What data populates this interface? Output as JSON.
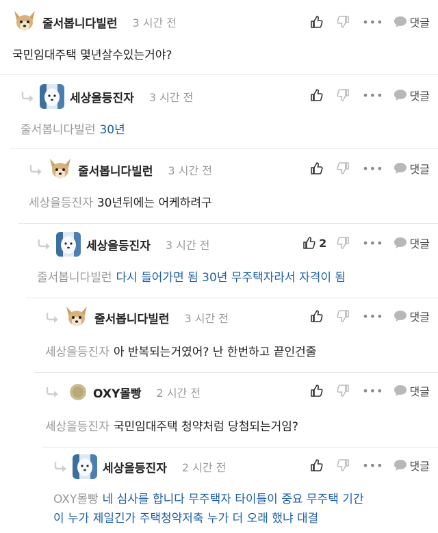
{
  "comments": [
    {
      "nick": "줄서봅니다빌런",
      "time": "3 시간 전",
      "likes": "",
      "mention": "",
      "text": "국민임대주택 몇년살수있는거야?",
      "reply_label": "댓글"
    },
    {
      "nick": "세상을등진자",
      "time": "3 시간 전",
      "likes": "",
      "mention": "줄서봅니다빌런",
      "text": "30년",
      "reply_label": "댓글"
    },
    {
      "nick": "줄서봅니다빌런",
      "time": "3 시간 전",
      "likes": "",
      "mention": "세상을등진자",
      "text": "30년뒤에는 어케하려구",
      "reply_label": "댓글"
    },
    {
      "nick": "세상을등진자",
      "time": "3 시간 전",
      "likes": "2",
      "mention": "줄서봅니다빌런",
      "text": "다시 들어가면 됨 30년 무주택자라서 자격이 됨",
      "reply_label": "댓글"
    },
    {
      "nick": "줄서봅니다빌런",
      "time": "3 시간 전",
      "likes": "",
      "mention": "세상을등진자",
      "text": "아 반복되는거였어? 난 한번하고 끝인건줄",
      "reply_label": "댓글"
    },
    {
      "nick": "OXY몰빵",
      "time": "2 시간 전",
      "likes": "",
      "mention": "세상을등진자",
      "text": "국민임대주택 청약처럼 당첨되는거임?",
      "reply_label": "댓글"
    },
    {
      "nick": "세상을등진자",
      "time": "2 시간 전",
      "likes": "",
      "mention": "OXY몰빵",
      "text": "네 심사를 합니다 무주택자 타이틀이 중요 무주택 기간",
      "text2": "이 누가 제일긴가 주택청약저축 누가 더 오래 했냐 대결",
      "reply_label": "댓글"
    }
  ],
  "more_label": "•••",
  "colors": {
    "reply_text": "#1f5fa8",
    "mention": "#999999",
    "time": "#999999",
    "divider": "#e6e6e6"
  }
}
